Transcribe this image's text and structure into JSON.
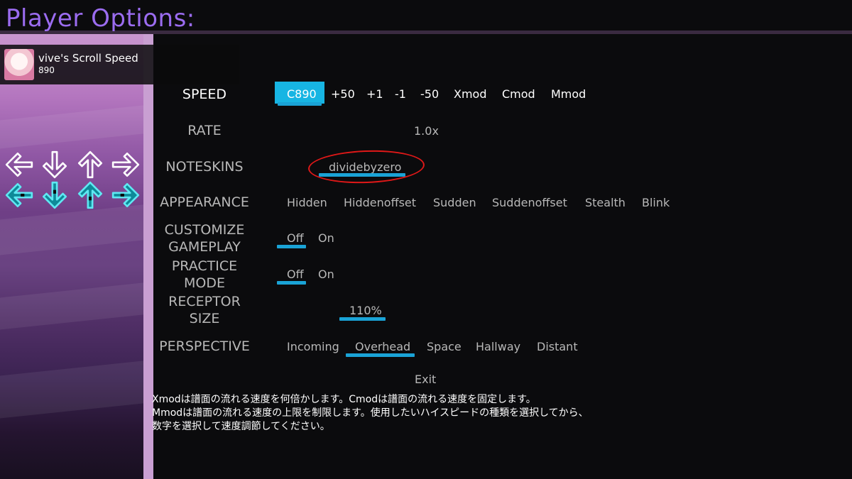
{
  "header": {
    "title": "Player Options:"
  },
  "profile": {
    "name": "vive's Scroll Speed",
    "value": "890"
  },
  "receptors": {
    "top_row": [
      "left-arrow-icon",
      "down-arrow-icon",
      "up-arrow-icon",
      "right-arrow-icon"
    ],
    "bottom_row": [
      "left-arrow-icon",
      "down-arrow-icon",
      "up-arrow-icon",
      "right-arrow-icon"
    ],
    "colors": {
      "outline": "#ffffff",
      "accent": "#19c6d8",
      "bright": "#7ff0f7"
    }
  },
  "options": {
    "speed": {
      "label": "SPEED",
      "choices": [
        "C890",
        "+50",
        "+1",
        "-1",
        "-50",
        "Xmod",
        "Cmod",
        "Mmod"
      ]
    },
    "rate": {
      "label": "RATE",
      "value": "1.0x"
    },
    "noteskins": {
      "label": "NOTESKINS",
      "value": "dividebyzero"
    },
    "appearance": {
      "label": "APPEARANCE",
      "choices": [
        "Hidden",
        "Hiddenoffset",
        "Sudden",
        "Suddenoffset",
        "Stealth",
        "Blink"
      ]
    },
    "customize_gameplay": {
      "label_line1": "CUSTOMIZE",
      "label_line2": "GAMEPLAY",
      "choices": [
        "Off",
        "On"
      ]
    },
    "practice_mode": {
      "label_line1": "PRACTICE",
      "label_line2": "MODE",
      "choices": [
        "Off",
        "On"
      ]
    },
    "receptor_size": {
      "label_line1": "RECEPTOR",
      "label_line2": "SIZE",
      "value": "110%"
    },
    "perspective": {
      "label": "PERSPECTIVE",
      "choices": [
        "Incoming",
        "Overhead",
        "Space",
        "Hallway",
        "Distant"
      ]
    }
  },
  "exit_label": "Exit",
  "description": {
    "line1": "Xmodは譜面の流れる速度を何倍かします。Cmodは譜面の流れる速度を固定します。",
    "line2": "Mmodは譜面の流れる速度の上限を制限します。使用したいハイスピードの種類を選択してから、",
    "line3": "数字を選択して速度調節してください。"
  },
  "colors": {
    "accent": "#17b5e3",
    "title": "#9b6cf0",
    "highlight_circle": "#e01818"
  }
}
